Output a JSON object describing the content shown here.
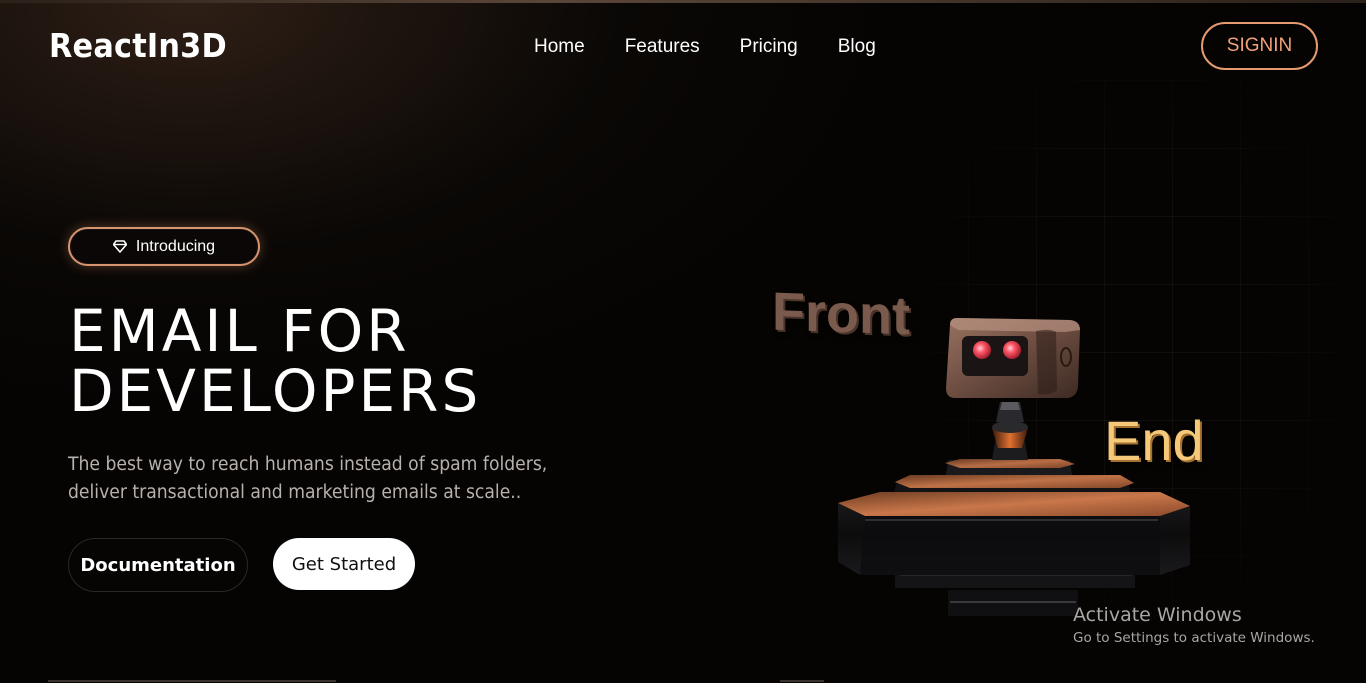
{
  "header": {
    "logo": "ReactIn3D",
    "nav": [
      "Home",
      "Features",
      "Pricing",
      "Blog"
    ],
    "signin_label": "SIGNIN"
  },
  "hero": {
    "badge": {
      "icon": "diamond-icon",
      "label": "Introducing"
    },
    "headline": [
      "EMAIL FOR",
      "DEVELOPERS"
    ],
    "subtext": "The best way to reach humans instead of spam folders, deliver transactional and marketing emails at scale..",
    "buttons": {
      "documentation": "Documentation",
      "get_started": "Get Started"
    }
  },
  "illustration": {
    "word_front": "Front",
    "word_end": "End",
    "object": "robot-on-pedestal"
  },
  "watermark": {
    "title": "Activate Windows",
    "subtitle": "Go to Settings to activate Windows."
  },
  "colors": {
    "background": "#050403",
    "accent": "#e59a6f",
    "end_text": "#f6c97a",
    "robot_eye": "#ff5a6a"
  }
}
